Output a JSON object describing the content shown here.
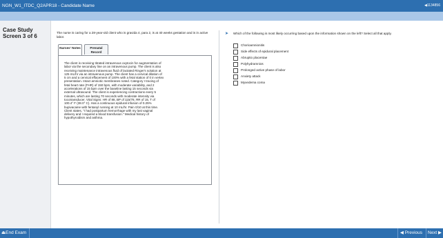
{
  "header": {
    "title": "NGN_W1_ITDC_Q2APR18 - Candidate Name",
    "right_label": "◀1134856"
  },
  "sidebar": {
    "case_label": "Case Study Screen 3 of 6"
  },
  "stem": {
    "text": "The nurse is caring for a 28-year-old client who is gravida 4, para 2, is at 40 weeks gestation and is in active labor."
  },
  "tabs": [
    {
      "label": "Nurses' Notes"
    },
    {
      "label": "Prenatal Record"
    }
  ],
  "notes": {
    "text": "The client is receiving titrated intravenous oxytocin for augmentation of labor via the secondary line on an intravenous pump. The client is also receiving maintenance intravenous fluid of lactated Ringer's solution at 125 mL/hr via an intravenous pump. The client has a cervical dilation of 5 cm and a cervical effacement of 100% with a fetal station of 0 in vertex presentation. Intact amniotic membranes noted. Category I tracing of fetal heart rate (FHR) of 150 bpm, with moderate variability, and 2 accelerations of 15 bpm over the baseline lasting 15 seconds via external ultrasound. The client is experiencing contractions every 5 minutes, which are lasting 70 seconds with moderate intensity via tocotransducer. Vital Signs: HR of 88, BP of 115/78, RR of 15, T of 100.4° F (38.0° C). Has a continuous epidural infusion of 0.25% bupivacaine with fentanyl running at 10 mL/hr. Pain 0/10 at this time. Client states, \"I had postpartum hemorrhage with my last vaginal delivery and I required a blood transfusion.\" Medical history of hypothyroidism and asthma."
  },
  "question": {
    "arrow": "➤",
    "text": "Which of the following is most likely occurring based upon the information shown on the left? Select all that apply.",
    "options": [
      {
        "label": "Chorioamnionitis"
      },
      {
        "label": "Side effects of epidural placement"
      },
      {
        "label": "Abruptio placentae"
      },
      {
        "label": "Polyhydramnios"
      },
      {
        "label": "Prolonged active phase of labor"
      },
      {
        "label": "Anxiety attack"
      },
      {
        "label": "Myxedema coma"
      }
    ]
  },
  "footer": {
    "end_exam": "⏏End Exam",
    "previous": "◀ Previous",
    "next": "Next ▶"
  },
  "colors": {
    "accent": "#2d6fb0",
    "subbar": "#a9c7e8",
    "sidebar_bg": "#eef0f3"
  }
}
